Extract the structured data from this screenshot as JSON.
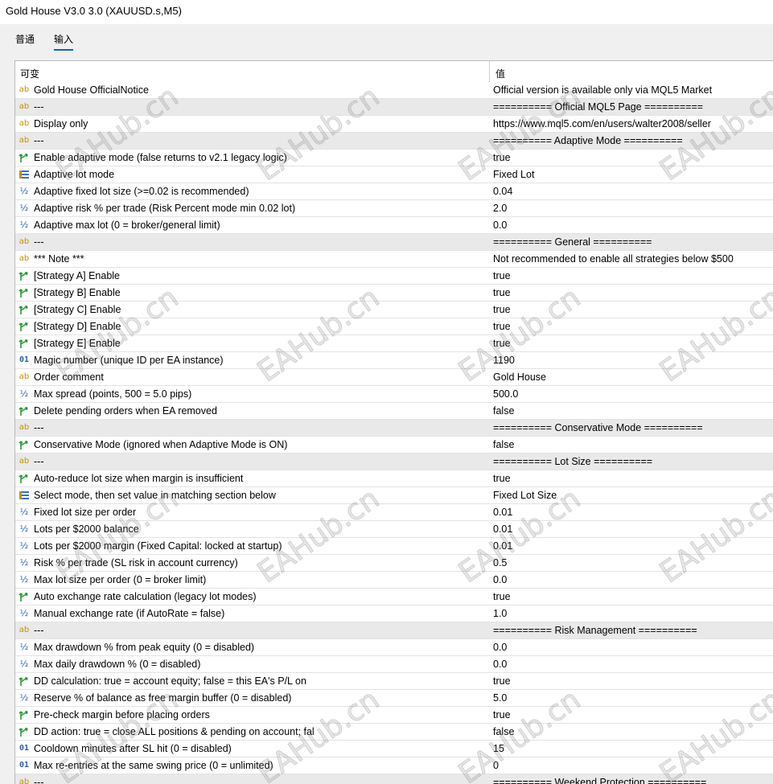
{
  "window": {
    "title": "Gold House V3.0 3.0 (XAUUSD.s,M5)"
  },
  "tabs": [
    {
      "label": "普通",
      "active": false
    },
    {
      "label": "输入",
      "active": true
    }
  ],
  "grid": {
    "header_variable": "可变",
    "header_value": "值",
    "rows": [
      {
        "type": "string",
        "name": "Gold House OfficialNotice",
        "value": "Official version is available only via MQL5 Market",
        "sep": false
      },
      {
        "type": "string",
        "name": "---",
        "value": "========== Official MQL5 Page ==========",
        "sep": true
      },
      {
        "type": "string",
        "name": "Display only",
        "value": "https://www.mql5.com/en/users/walter2008/seller",
        "sep": false
      },
      {
        "type": "string",
        "name": "---",
        "value": "========== Adaptive Mode ==========",
        "sep": true
      },
      {
        "type": "bool",
        "name": "Enable adaptive mode (false returns to v2.1 legacy logic)",
        "value": "true",
        "sep": false
      },
      {
        "type": "enum",
        "name": "Adaptive lot mode",
        "value": "Fixed Lot",
        "sep": false
      },
      {
        "type": "double",
        "name": "Adaptive fixed lot size (>=0.02 is recommended)",
        "value": "0.04",
        "sep": false
      },
      {
        "type": "double",
        "name": "Adaptive risk % per trade (Risk Percent mode min 0.02 lot)",
        "value": "2.0",
        "sep": false
      },
      {
        "type": "double",
        "name": "Adaptive max lot (0 = broker/general limit)",
        "value": "0.0",
        "sep": false
      },
      {
        "type": "string",
        "name": "---",
        "value": "========== General ==========",
        "sep": true
      },
      {
        "type": "string",
        "name": "*** Note ***",
        "value": "Not recommended to enable all strategies below $500",
        "sep": false
      },
      {
        "type": "bool",
        "name": "[Strategy A] Enable",
        "value": "true",
        "sep": false
      },
      {
        "type": "bool",
        "name": "[Strategy B] Enable",
        "value": "true",
        "sep": false
      },
      {
        "type": "bool",
        "name": "[Strategy C] Enable",
        "value": "true",
        "sep": false
      },
      {
        "type": "bool",
        "name": "[Strategy D] Enable",
        "value": "true",
        "sep": false
      },
      {
        "type": "bool",
        "name": "[Strategy E] Enable",
        "value": "true",
        "sep": false
      },
      {
        "type": "int",
        "name": "Magic number (unique ID per EA instance)",
        "value": "1190",
        "sep": false
      },
      {
        "type": "string",
        "name": "Order comment",
        "value": "Gold House",
        "sep": false
      },
      {
        "type": "double",
        "name": "Max spread (points, 500 = 5.0 pips)",
        "value": "500.0",
        "sep": false
      },
      {
        "type": "bool",
        "name": "Delete pending orders when EA removed",
        "value": "false",
        "sep": false
      },
      {
        "type": "string",
        "name": "---",
        "value": "========== Conservative Mode ==========",
        "sep": true
      },
      {
        "type": "bool",
        "name": "Conservative Mode (ignored when Adaptive Mode is ON)",
        "value": "false",
        "sep": false
      },
      {
        "type": "string",
        "name": "---",
        "value": "========== Lot Size ==========",
        "sep": true
      },
      {
        "type": "bool",
        "name": "Auto-reduce lot size when margin is insufficient",
        "value": "true",
        "sep": false
      },
      {
        "type": "enum",
        "name": "Select mode, then set value in matching section below",
        "value": "Fixed Lot Size",
        "sep": false
      },
      {
        "type": "double",
        "name": "Fixed lot size per order",
        "value": "0.01",
        "sep": false
      },
      {
        "type": "double",
        "name": "Lots per $2000 balance",
        "value": "0.01",
        "sep": false
      },
      {
        "type": "double",
        "name": "Lots per $2000 margin (Fixed Capital: locked at startup)",
        "value": "0.01",
        "sep": false
      },
      {
        "type": "double",
        "name": "Risk % per trade (SL risk in account currency)",
        "value": "0.5",
        "sep": false
      },
      {
        "type": "double",
        "name": "Max lot size per order (0 = broker limit)",
        "value": "0.0",
        "sep": false
      },
      {
        "type": "bool",
        "name": "Auto exchange rate calculation (legacy lot modes)",
        "value": "true",
        "sep": false
      },
      {
        "type": "double",
        "name": "Manual exchange rate (if AutoRate = false)",
        "value": "1.0",
        "sep": false
      },
      {
        "type": "string",
        "name": "---",
        "value": "========== Risk Management ==========",
        "sep": true
      },
      {
        "type": "double",
        "name": "Max drawdown % from peak equity (0 = disabled)",
        "value": "0.0",
        "sep": false
      },
      {
        "type": "double",
        "name": "Max daily drawdown % (0 = disabled)",
        "value": "0.0",
        "sep": false
      },
      {
        "type": "bool",
        "name": "DD calculation: true = account equity; false = this EA's P/L on",
        "value": "true",
        "sep": false
      },
      {
        "type": "double",
        "name": "Reserve % of balance as free margin buffer (0 = disabled)",
        "value": "5.0",
        "sep": false
      },
      {
        "type": "bool",
        "name": "Pre-check margin before placing orders",
        "value": "true",
        "sep": false
      },
      {
        "type": "bool",
        "name": "DD action: true = close ALL positions & pending on account; fal",
        "value": "false",
        "sep": false
      },
      {
        "type": "int",
        "name": "Cooldown minutes after SL hit (0 = disabled)",
        "value": "15",
        "sep": false
      },
      {
        "type": "int",
        "name": "Max re-entries at the same swing price (0 = unlimited)",
        "value": "0",
        "sep": false
      },
      {
        "type": "string",
        "name": "---",
        "value": "========== Weekend Protection ==========",
        "sep": true
      }
    ]
  },
  "icons": {
    "string": "ab",
    "int": "01",
    "double": "½",
    "bool": "bool-arrow-icon",
    "enum": "enum-list-icon"
  },
  "watermark": "EAHub.cn",
  "colors": {
    "tab_underline": "#0a64c8",
    "separator_row": "#e9e9e9",
    "bool_icon": "#2e9a3a",
    "string_icon": "#c49000"
  }
}
